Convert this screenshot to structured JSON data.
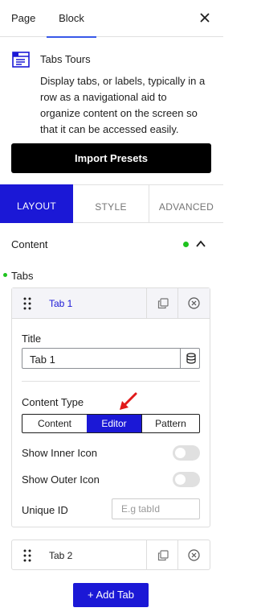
{
  "header": {
    "tab_page": "Page",
    "tab_block": "Block"
  },
  "block": {
    "title": "Tabs Tours",
    "description": "Display tabs, or labels, typically in a row as a navigational aid to organize content on the screen so that it can be accessed easily."
  },
  "import_button": "Import Presets",
  "panel_tabs": {
    "layout": "LAYOUT",
    "style": "STYLE",
    "advanced": "ADVANCED"
  },
  "content_section": {
    "title": "Content"
  },
  "tabs": {
    "label": "Tabs",
    "items": [
      {
        "name": "Tab 1",
        "title_label": "Title",
        "title_value": "Tab 1",
        "content_type_label": "Content Type",
        "content_type_options": [
          "Content",
          "Editor",
          "Pattern"
        ],
        "content_type_selected": "Editor",
        "show_inner_icon_label": "Show Inner Icon",
        "show_outer_icon_label": "Show Outer Icon",
        "unique_id_label": "Unique ID",
        "unique_id_placeholder": "E.g tabId"
      },
      {
        "name": "Tab 2"
      }
    ],
    "add_button": "+ Add Tab"
  },
  "colors": {
    "accent": "#1b18d6",
    "status_dot": "#1ec31e",
    "annotation_arrow": "#e11a1a"
  }
}
